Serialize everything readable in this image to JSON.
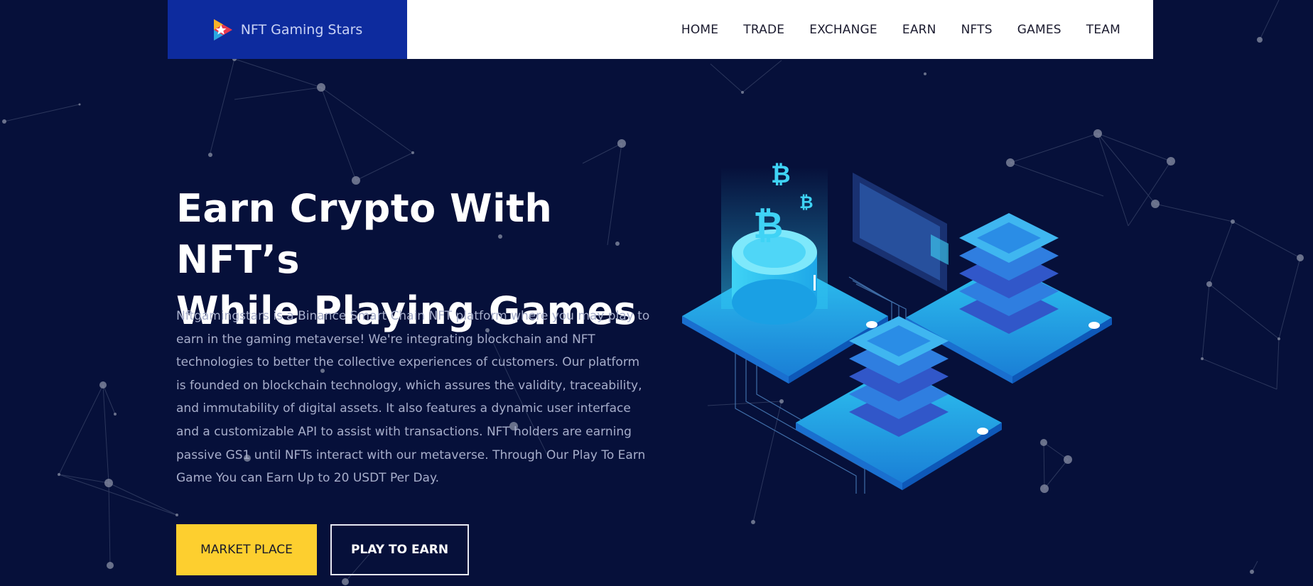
{
  "brand": {
    "name": "NFT Gaming Stars",
    "logo_icon": "play-star-logo-icon"
  },
  "nav": {
    "items": [
      {
        "label": "HOME"
      },
      {
        "label": "TRADE"
      },
      {
        "label": "EXCHANGE"
      },
      {
        "label": "EARN"
      },
      {
        "label": "NFTS"
      },
      {
        "label": "GAMES"
      },
      {
        "label": "TEAM"
      }
    ]
  },
  "hero": {
    "title_line1": "Earn Crypto With NFT’s",
    "title_line2": "While Playing Games",
    "description": "Nftgamingstars is a Binance Smart Chain NFT platform where you may play to earn in the gaming metaverse! We're integrating blockchain and NFT technologies to better the collective experiences of customers. Our platform is founded on blockchain technology, which assures the validity, traceability, and immutability of digital assets. It also features a dynamic user interface and a customizable API to assist with transactions. NFT holders are earning passive GS1 until NFTs interact with our metaverse. Through Our Play To Earn Game You can Earn Up to 20 USDT Per Day.",
    "buttons": {
      "market_place": "MARKET PLACE",
      "play_to_earn": "PLAY TO EARN"
    },
    "illustration": "isometric-bitcoin-server-illustration"
  },
  "colors": {
    "background": "#06103a",
    "header_bg": "#ffffff",
    "brand_bg": "#0d2b9e",
    "accent_yellow": "#fdcf2f",
    "illustration_cyan": "#2ec4f0"
  }
}
